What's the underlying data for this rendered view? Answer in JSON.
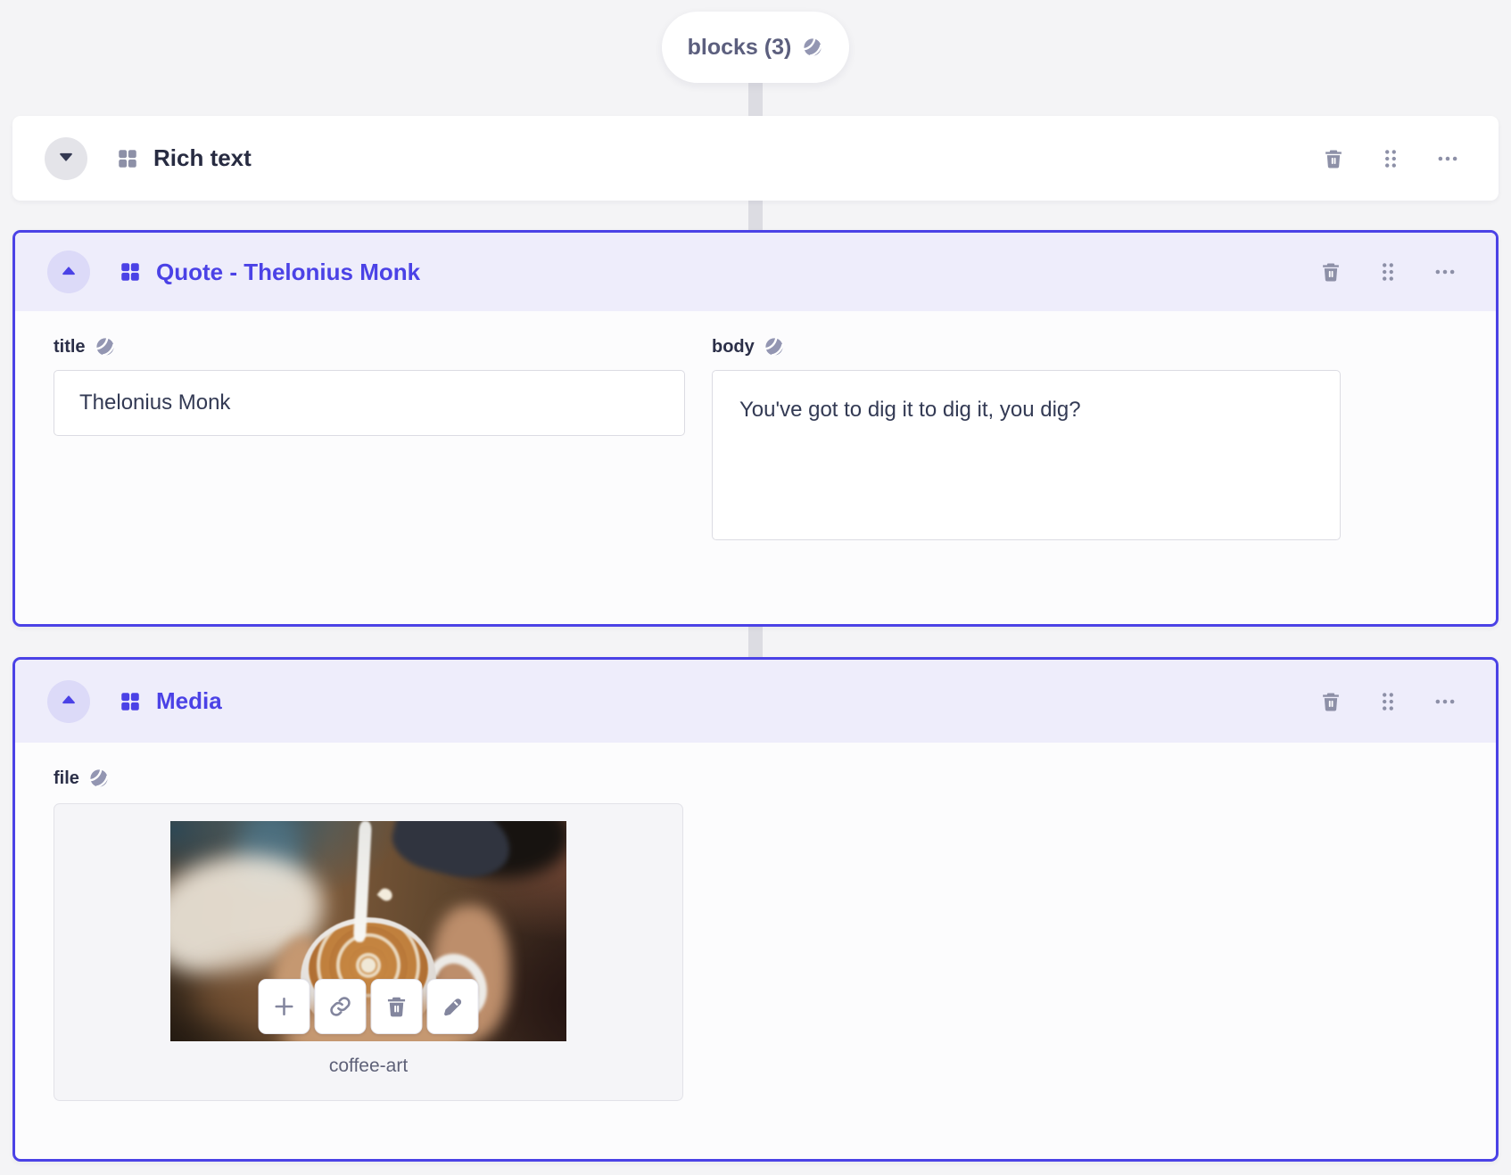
{
  "pill": {
    "label": "blocks (3)"
  },
  "blocks": [
    {
      "label": "Rich text",
      "state": "collapsed"
    },
    {
      "label": "Quote - Thelonius Monk",
      "state": "expanded",
      "fields": {
        "title": {
          "label": "title",
          "value": "Thelonius Monk"
        },
        "body": {
          "label": "body",
          "value": "You've got to dig it to dig it, you dig?"
        }
      }
    },
    {
      "label": "Media",
      "state": "expanded",
      "fields": {
        "file": {
          "label": "file",
          "filename": "coffee-art"
        }
      }
    }
  ],
  "icons": {
    "globe": "globe-icon",
    "block_type": "blocks-grid-icon",
    "collapse_expanded": "triangle-up-icon",
    "collapse_collapsed": "triangle-down-icon",
    "delete": "trash-icon",
    "drag": "drag-dots-icon",
    "more": "ellipsis-icon",
    "add": "plus-icon",
    "link": "link-icon",
    "edit": "pencil-icon"
  },
  "colors": {
    "accent": "#4b42e6",
    "accent_header_bg": "#eeedfb",
    "icon_gray": "#8d90a7",
    "page_bg": "#f4f4f6"
  }
}
